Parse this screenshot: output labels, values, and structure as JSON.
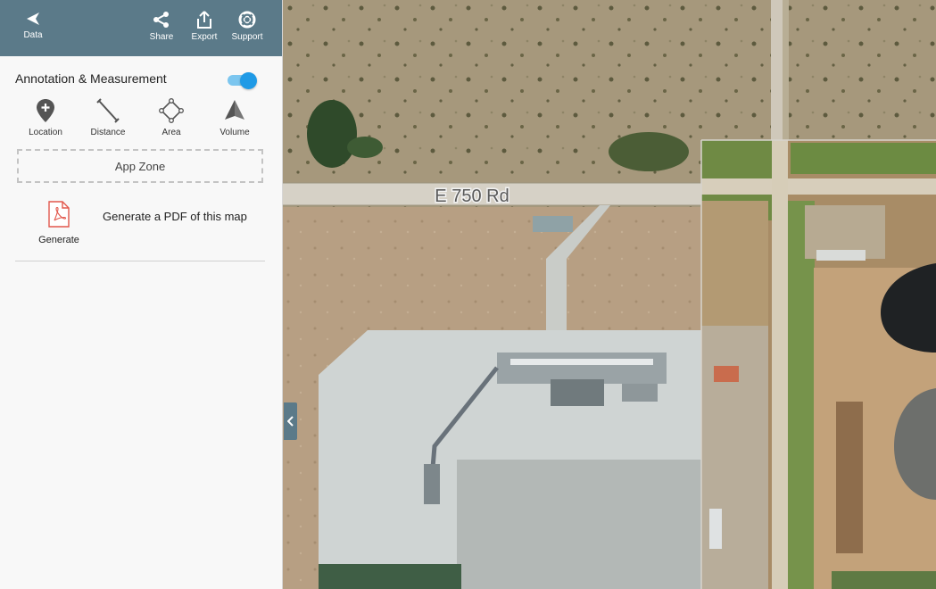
{
  "topbar": {
    "data_label": "Data",
    "share_label": "Share",
    "export_label": "Export",
    "support_label": "Support"
  },
  "annotation": {
    "title": "Annotation & Measurement",
    "toggle_on": true,
    "tools": {
      "location": "Location",
      "distance": "Distance",
      "area": "Area",
      "volume": "Volume"
    }
  },
  "app_zone": {
    "label": "App Zone"
  },
  "generate": {
    "label": "Generate",
    "description": "Generate a PDF of this map"
  },
  "map": {
    "road_label": "E 750 Rd"
  },
  "colors": {
    "topbar": "#5b7a89",
    "toggle_accent": "#1f9ae6",
    "pdf_icon": "#e2574c"
  },
  "icons": {
    "back": "chevron-left-icon",
    "share": "share-icon",
    "export": "export-icon",
    "support": "lifebuoy-icon",
    "location": "map-pin-plus-icon",
    "distance": "ruler-line-icon",
    "area": "polygon-icon",
    "volume": "cone-icon",
    "pdf": "pdf-file-icon",
    "collapse": "chevron-left-icon"
  }
}
